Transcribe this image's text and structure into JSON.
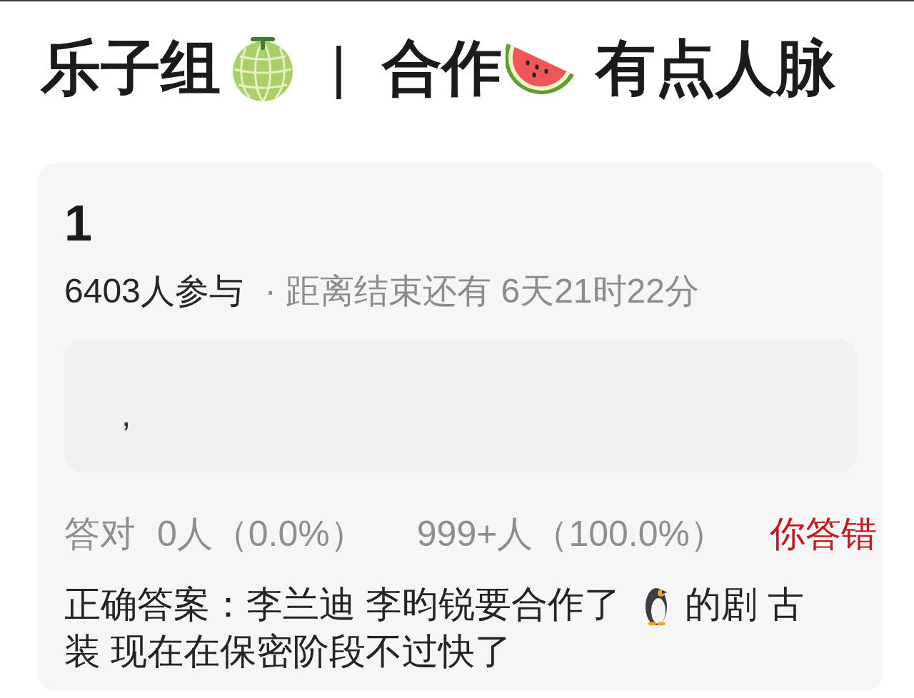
{
  "header": {
    "left": "乐子组",
    "separator": "|",
    "middle": "合作",
    "right": "有点人脉"
  },
  "poll": {
    "number": "1",
    "participants": "6403人参与",
    "countdown": "· 距离结束还有 6天21时22分",
    "content": ",",
    "results": [
      {
        "label": "答对",
        "count": "0人（0.0%）"
      },
      {
        "count": "999+人（100.0%）"
      }
    ],
    "verdict": {
      "text": "你答错",
      "correct": false
    },
    "correct_answer": {
      "before": "正确答案：李兰迪 李昀锐要合作了",
      "after": "的剧 古",
      "continued": "装 现在在保密阶段不过快了"
    }
  }
}
